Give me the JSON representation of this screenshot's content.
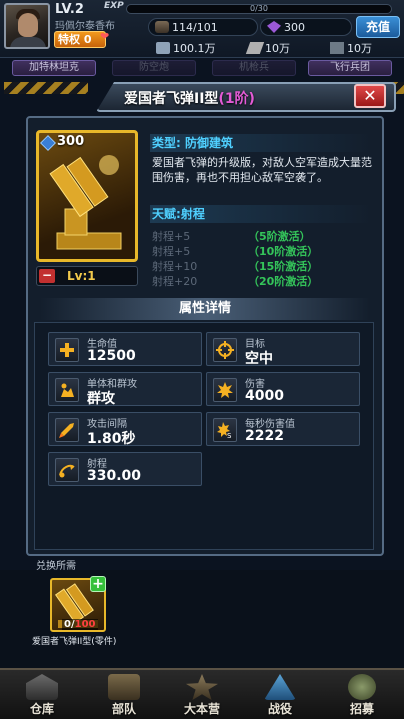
{
  "hud": {
    "level": "LV.2",
    "exp_label": "EXP",
    "exp_text": "0/30",
    "player_name": "玛佩尔泰香布",
    "vip_label": "特权 0",
    "oil": "114/101",
    "gems": "300",
    "recharge": "充值",
    "steel": "100.1万",
    "ammo": "10万",
    "alloy": "10万"
  },
  "background": {
    "tabs": [
      "加特林坦克",
      "防空炮",
      "机枪兵",
      "飞行兵团"
    ]
  },
  "modal": {
    "title": "爱国者飞弹II型",
    "title_level": "(1阶)",
    "close": "✕",
    "card_power": "300",
    "card_level": "Lv:1",
    "type_label": "类型:",
    "type_value": "防御建筑",
    "description": "爱国者飞弹的升级版，对敌人空军造成大量范围伤害，再也不用担心敌军空袭了。",
    "talent_label": "天赋:",
    "talent_value": "射程",
    "talents": [
      {
        "bonus": "射程+5",
        "condition": "（5阶激活）"
      },
      {
        "bonus": "射程+5",
        "condition": "（10阶激活）"
      },
      {
        "bonus": "射程+10",
        "condition": "（15阶激活）"
      },
      {
        "bonus": "射程+20",
        "condition": "（20阶激活）"
      }
    ],
    "attr_header": "属性详情",
    "stats": [
      {
        "label": "生命值",
        "value": "12500",
        "icon": "plus-health-icon"
      },
      {
        "label": "目标",
        "value": "空中",
        "icon": "crosshair-icon"
      },
      {
        "label": "单体和群攻",
        "value": "群攻",
        "icon": "splash-attack-icon"
      },
      {
        "label": "伤害",
        "value": "4000",
        "icon": "explosion-icon"
      },
      {
        "label": "攻击间隔",
        "value": "1.80秒",
        "icon": "missile-icon"
      },
      {
        "label": "每秒伤害值",
        "value": "2222",
        "icon": "dps-icon"
      },
      {
        "label": "射程",
        "value": "330.00",
        "icon": "range-icon"
      }
    ],
    "exchange_label": "兑换所需",
    "exchange_item": {
      "have": "0",
      "need": "100",
      "name": "爱国者飞弹II型(零件)"
    }
  },
  "nav": [
    {
      "label": "仓库",
      "icon": "warehouse-icon"
    },
    {
      "label": "部队",
      "icon": "troops-icon"
    },
    {
      "label": "大本营",
      "icon": "headquarters-icon"
    },
    {
      "label": "战役",
      "icon": "campaign-icon"
    },
    {
      "label": "招募",
      "icon": "recruit-icon"
    }
  ],
  "colors": {
    "accent": "#4fd0ff",
    "gold": "#e8b82a",
    "talent_active": "#34c45a",
    "title_level": "#e45bd6",
    "need_red": "#ff4040"
  }
}
